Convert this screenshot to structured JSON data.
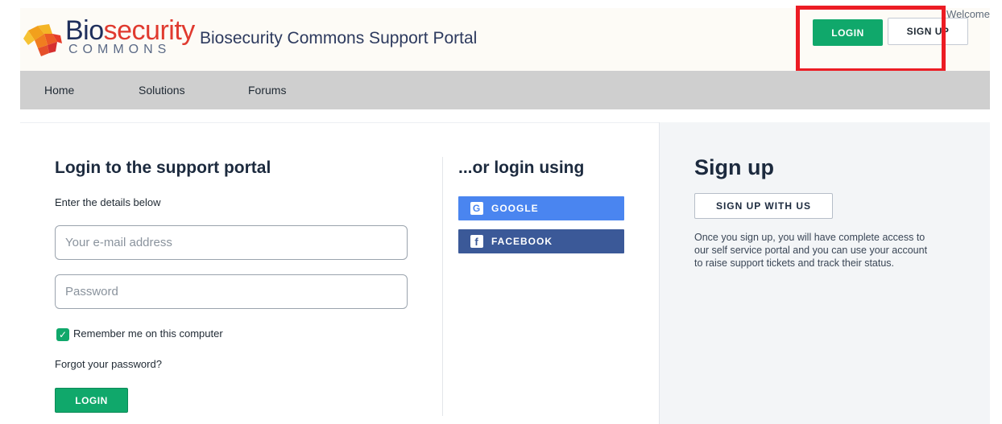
{
  "header": {
    "logo_word_primary": "Bio",
    "logo_word_accent": "security",
    "logo_word_secondary": "COMMONS",
    "portal_title": "Biosecurity Commons Support Portal",
    "welcome": "Welcome",
    "login_label": "LOGIN",
    "signup_label": "SIGN UP"
  },
  "nav": {
    "items": [
      {
        "label": "Home"
      },
      {
        "label": "Solutions"
      },
      {
        "label": "Forums"
      }
    ]
  },
  "login_form": {
    "title": "Login to the support portal",
    "subtitle": "Enter the details below",
    "email_placeholder": "Your e-mail address",
    "password_placeholder": "Password",
    "remember_label": "Remember me on this computer",
    "remember_checked": true,
    "forgot_label": "Forgot your password?",
    "login_label": "LOGIN"
  },
  "social": {
    "title": "...or login using",
    "google_label": "GOOGLE",
    "facebook_label": "FACEBOOK",
    "google_icon": "google-g-icon",
    "facebook_icon": "facebook-f-icon"
  },
  "signup": {
    "title": "Sign up",
    "button_label": "SIGN UP WITH US",
    "description": "Once you sign up, you will have complete access to our self service portal and you can use your account to raise support tickets and track their status."
  },
  "colors": {
    "accent_green": "#10a86b",
    "highlight_red": "#ec1c24",
    "google_blue": "#4a85f0",
    "facebook_blue": "#3b5998"
  }
}
